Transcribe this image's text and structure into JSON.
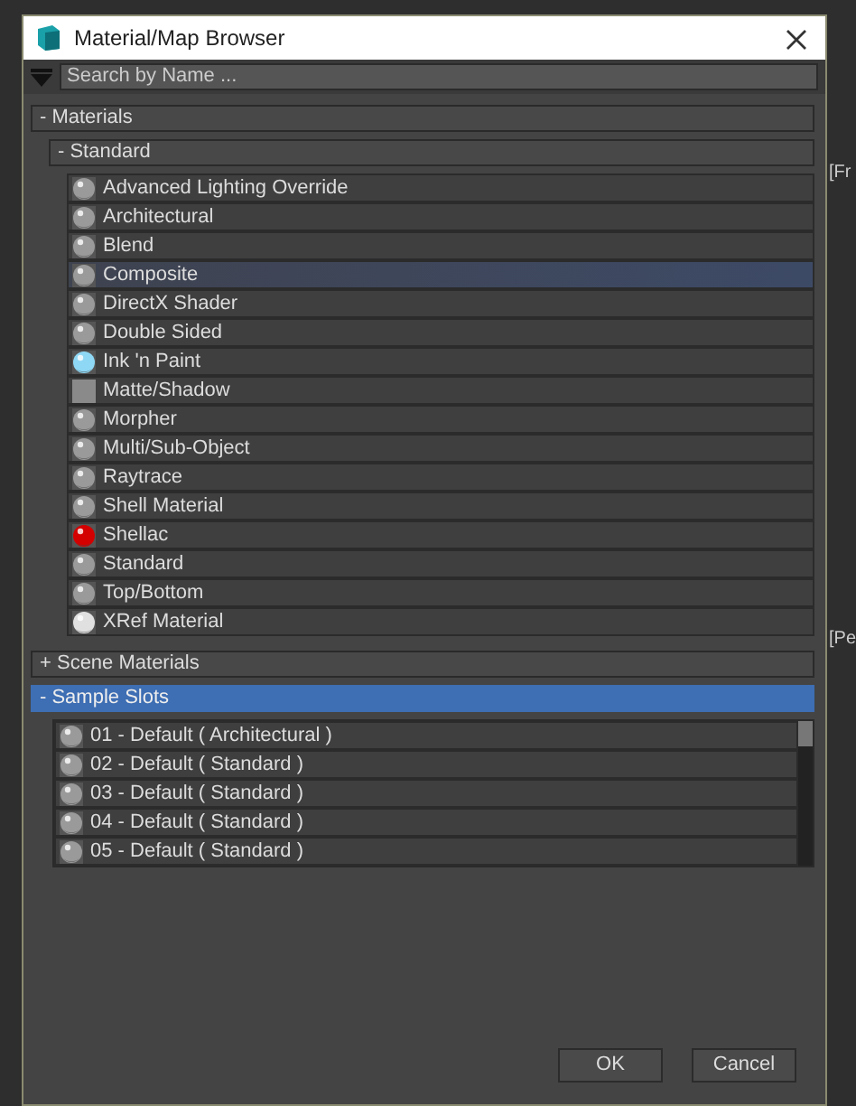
{
  "background": {
    "viewport_labels": [
      "[Fr",
      "[Pe"
    ]
  },
  "window": {
    "title": "Material/Map Browser"
  },
  "search": {
    "placeholder": "Search by Name ..."
  },
  "groups": [
    {
      "sign": "-",
      "label": "Materials",
      "selected": false,
      "subgroups": [
        {
          "sign": "-",
          "label": "Standard",
          "items": [
            {
              "label": "Advanced Lighting Override",
              "kind": "sphere",
              "color": "#9a9a9a",
              "selected": false
            },
            {
              "label": "Architectural",
              "kind": "sphere",
              "color": "#9a9a9a",
              "selected": false
            },
            {
              "label": "Blend",
              "kind": "sphere",
              "color": "#9a9a9a",
              "selected": false
            },
            {
              "label": "Composite",
              "kind": "sphere",
              "color": "#9a9a9a",
              "selected": true
            },
            {
              "label": "DirectX Shader",
              "kind": "sphere",
              "color": "#9a9a9a",
              "selected": false
            },
            {
              "label": "Double Sided",
              "kind": "sphere",
              "color": "#9a9a9a",
              "selected": false
            },
            {
              "label": "Ink 'n Paint",
              "kind": "sphere",
              "color": "#8fd8f5",
              "selected": false
            },
            {
              "label": "Matte/Shadow",
              "kind": "square",
              "color": "#8a8a8a",
              "selected": false
            },
            {
              "label": "Morpher",
              "kind": "sphere",
              "color": "#9a9a9a",
              "selected": false
            },
            {
              "label": "Multi/Sub-Object",
              "kind": "sphere",
              "color": "#9a9a9a",
              "selected": false
            },
            {
              "label": "Raytrace",
              "kind": "sphere",
              "color": "#9a9a9a",
              "selected": false
            },
            {
              "label": "Shell Material",
              "kind": "sphere",
              "color": "#9a9a9a",
              "selected": false
            },
            {
              "label": "Shellac",
              "kind": "sphere",
              "color": "#d40000",
              "selected": false
            },
            {
              "label": "Standard",
              "kind": "sphere",
              "color": "#9a9a9a",
              "selected": false
            },
            {
              "label": "Top/Bottom",
              "kind": "sphere",
              "color": "#9a9a9a",
              "selected": false
            },
            {
              "label": "XRef Material",
              "kind": "sphere",
              "color": "#e0e0e0",
              "selected": false
            }
          ]
        }
      ]
    },
    {
      "sign": "+",
      "label": "Scene Materials",
      "selected": false
    },
    {
      "sign": "-",
      "label": "Sample Slots",
      "selected": true,
      "slots": [
        {
          "label": "01 - Default  ( Architectural )",
          "kind": "sphere",
          "color": "#9a9a9a"
        },
        {
          "label": "02 - Default  ( Standard )",
          "kind": "sphere",
          "color": "#9a9a9a"
        },
        {
          "label": "03 - Default  ( Standard )",
          "kind": "sphere",
          "color": "#9a9a9a"
        },
        {
          "label": "04 - Default  ( Standard )",
          "kind": "sphere",
          "color": "#9a9a9a"
        },
        {
          "label": "05 - Default  ( Standard )",
          "kind": "sphere",
          "color": "#9a9a9a"
        }
      ]
    }
  ],
  "buttons": [
    "OK",
    "Cancel"
  ]
}
